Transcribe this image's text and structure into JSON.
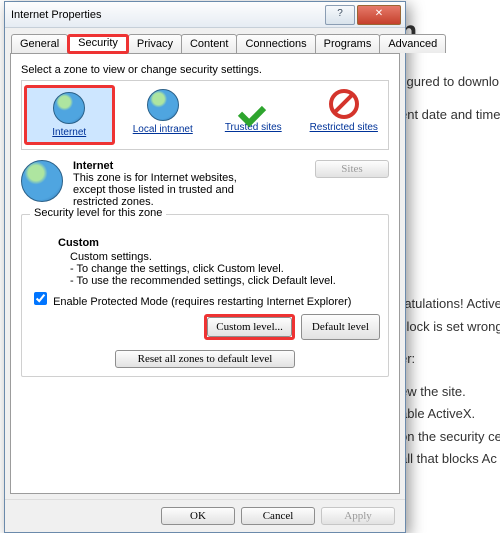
{
  "bg": {
    "heading_frag": "n",
    "p1": "figured to downlo",
    "p2": "ent date and time s",
    "p3": "ratulations! Active",
    "p4": "clock is set wrong!",
    "p5": "er:",
    "p6": "ew the site.",
    "p7": "able ActiveX.",
    "p8": "on the security ce",
    "p9": "all that blocks Ac"
  },
  "dialog": {
    "title": "Internet Properties"
  },
  "tabs": {
    "general": "General",
    "security": "Security",
    "privacy": "Privacy",
    "content": "Content",
    "connections": "Connections",
    "programs": "Programs",
    "advanced": "Advanced"
  },
  "zoneprompt": "Select a zone to view or change security settings.",
  "zones": {
    "internet": "Internet",
    "intranet": "Local intranet",
    "trusted": "Trusted sites",
    "restricted": "Restricted sites"
  },
  "zoneinfo": {
    "name": "Internet",
    "desc": "This zone is for Internet websites, except those listed in trusted and restricted zones.",
    "sites": "Sites"
  },
  "level": {
    "group": "Security level for this zone",
    "name": "Custom",
    "l1": "Custom settings.",
    "l2": "- To change the settings, click Custom level.",
    "l3": "- To use the recommended settings, click Default level.",
    "protected": "Enable Protected Mode (requires restarting Internet Explorer)",
    "custom": "Custom level...",
    "default": "Default level",
    "resetall": "Reset all zones to default level"
  },
  "buttons": {
    "ok": "OK",
    "cancel": "Cancel",
    "apply": "Apply"
  }
}
